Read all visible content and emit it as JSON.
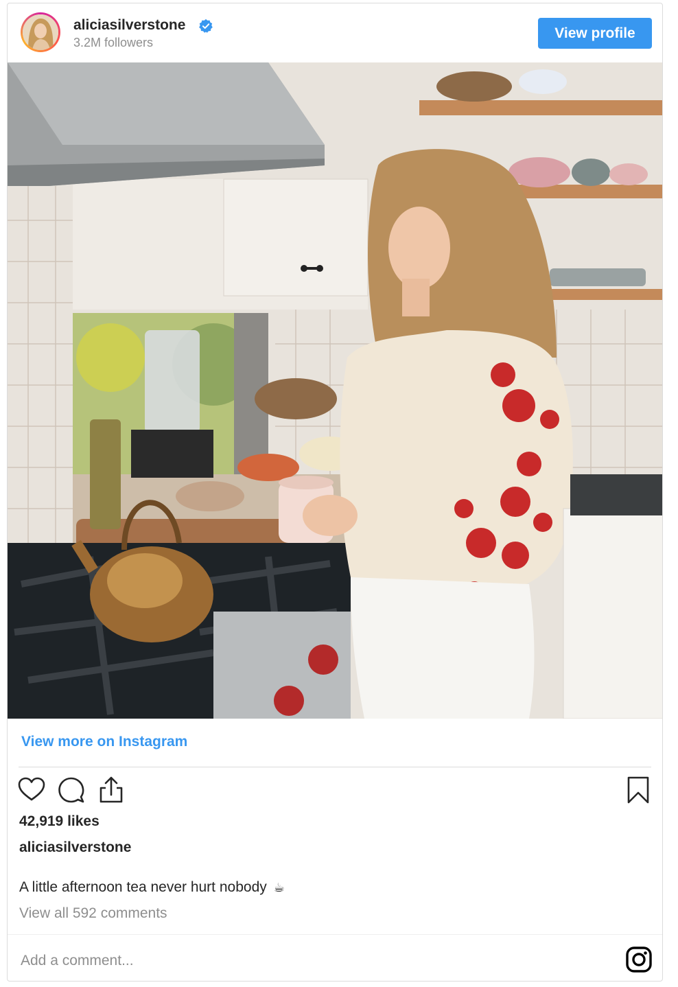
{
  "header": {
    "username": "aliciasilverstone",
    "followers": "3.2M followers",
    "view_profile_label": "View profile",
    "verified_icon": "verified-badge-icon",
    "avatar": "profile-avatar"
  },
  "post": {
    "photo": "kitchen-photo",
    "view_more_label": "View more on Instagram",
    "likes": "42,919 likes",
    "caption_user": "aliciasilverstone",
    "caption_text": "A little afternoon tea never hurt nobody",
    "caption_emoji": "☕",
    "view_comments": "View all 592 comments"
  },
  "actions": {
    "icons": [
      "heart-icon",
      "comment-icon",
      "share-icon",
      "bookmark-icon"
    ]
  },
  "comment_box": {
    "placeholder": "Add a comment..."
  },
  "colors": {
    "accent": "#3897f0",
    "text": "#262626",
    "muted": "#8e8e8e",
    "border": "#dbdbdb"
  }
}
